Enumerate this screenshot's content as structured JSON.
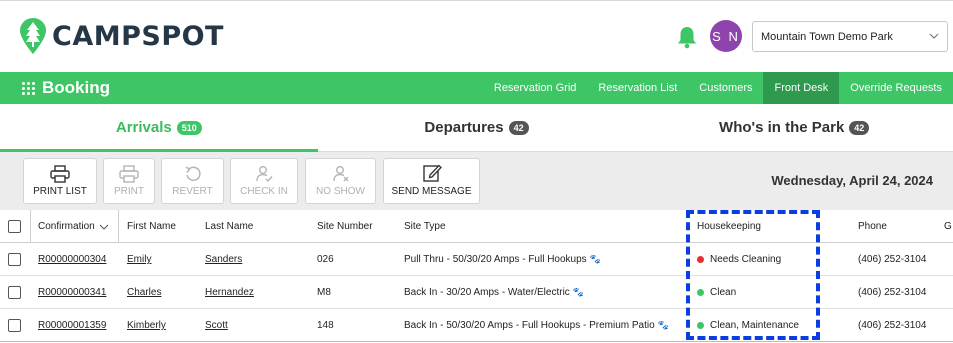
{
  "header": {
    "logo_text": "CAMPSPOT",
    "bell_icon": "bell-icon",
    "avatar_initials": "S N",
    "park_select": "Mountain Town Demo Park",
    "colors": {
      "brand_green": "#3dc566",
      "avatar": "#8e44ad",
      "logo_text": "#253746"
    }
  },
  "nav": {
    "brand": "Booking",
    "links": [
      "Reservation Grid",
      "Reservation List",
      "Customers",
      "Front Desk",
      "Override Requests"
    ],
    "active": "Front Desk"
  },
  "tabs": [
    {
      "label": "Arrivals",
      "count": "510",
      "active": true
    },
    {
      "label": "Departures",
      "count": "42",
      "active": false
    },
    {
      "label": "Who's in the Park",
      "count": "42",
      "active": false
    }
  ],
  "toolbar": {
    "buttons": [
      {
        "label": "PRINT LIST",
        "icon": "printer-icon",
        "enabled": true
      },
      {
        "label": "PRINT",
        "icon": "printer-icon",
        "enabled": false
      },
      {
        "label": "REVERT",
        "icon": "undo-icon",
        "enabled": false
      },
      {
        "label": "CHECK IN",
        "icon": "person-check-icon",
        "enabled": false
      },
      {
        "label": "NO SHOW",
        "icon": "person-x-icon",
        "enabled": false
      },
      {
        "label": "SEND MESSAGE",
        "icon": "edit-icon",
        "enabled": true
      }
    ],
    "date": "Wednesday, April 24, 2024"
  },
  "table": {
    "columns": [
      "Confirmation",
      "First Name",
      "Last Name",
      "Site Number",
      "Site Type",
      "Housekeeping",
      "Phone",
      "G"
    ],
    "rows": [
      {
        "confirmation": "R00000000304",
        "first": "Emily",
        "last": "Sanders",
        "site": "026",
        "type": "Pull Thru - 50/30/20 Amps - Full Hookups",
        "housekeeping": "Needs Cleaning",
        "status_color": "red",
        "phone": "(406) 252-3104"
      },
      {
        "confirmation": "R00000000341",
        "first": "Charles",
        "last": "Hernandez",
        "site": "M8",
        "type": "Back In - 30/20 Amps - Water/Electric",
        "housekeeping": "Clean",
        "status_color": "green",
        "phone": "(406) 252-3104"
      },
      {
        "confirmation": "R00000001359",
        "first": "Kimberly",
        "last": "Scott",
        "site": "148",
        "type": "Back In - 50/30/20 Amps - Full Hookups - Premium Patio",
        "housekeeping": "Clean, Maintenance",
        "status_color": "green",
        "phone": "(406) 252-3104"
      }
    ]
  }
}
